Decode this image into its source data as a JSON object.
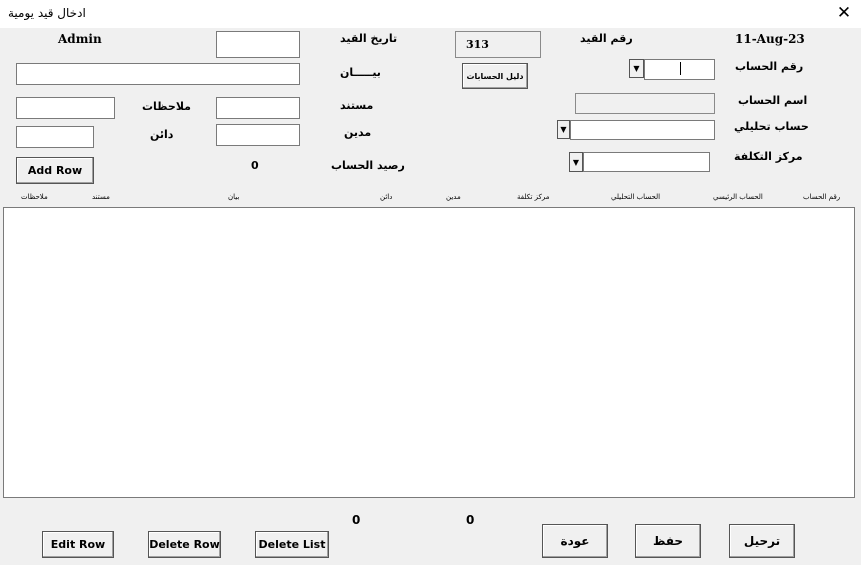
{
  "window": {
    "title": "ادخال قيد يومية",
    "close_glyph": "✕"
  },
  "header": {
    "user": "Admin",
    "date": "11-Aug-23",
    "entry_date_label": "تاريخ القيد",
    "entry_no_label": "رقم القيد",
    "entry_no_value": "313"
  },
  "form": {
    "statement_label": "بيـــــان",
    "accounts_guide_button": "دليل الحسابات",
    "account_no_label": "رقم الحساب",
    "account_name_label": "اسم الحساب",
    "analytical_account_label": "حساب تحليلي",
    "cost_center_label": "مركز التكلفة",
    "notes_label": "ملاحظات",
    "document_label": "مستند",
    "credit_label": "دائن",
    "debit_label": "مدين",
    "balance_label": "رصيد الحساب",
    "balance_value": "0",
    "add_row_button": "Add Row",
    "dropdown_glyph": "▼"
  },
  "grid": {
    "columns": [
      "رقم الحساب",
      "الحساب الرئيسي",
      "الحساب التحليلي",
      "مركز تكلفة",
      "مدين",
      "دائن",
      "بيان",
      "مستند",
      "ملاحظات"
    ],
    "rows": []
  },
  "footer": {
    "total_debit": "0",
    "total_credit": "0",
    "edit_row_button": "Edit Row",
    "delete_row_button": "Delete Row",
    "delete_list_button": "Delete List",
    "back_button": "عودة",
    "save_button": "حفظ",
    "post_button": "ترحيل"
  }
}
